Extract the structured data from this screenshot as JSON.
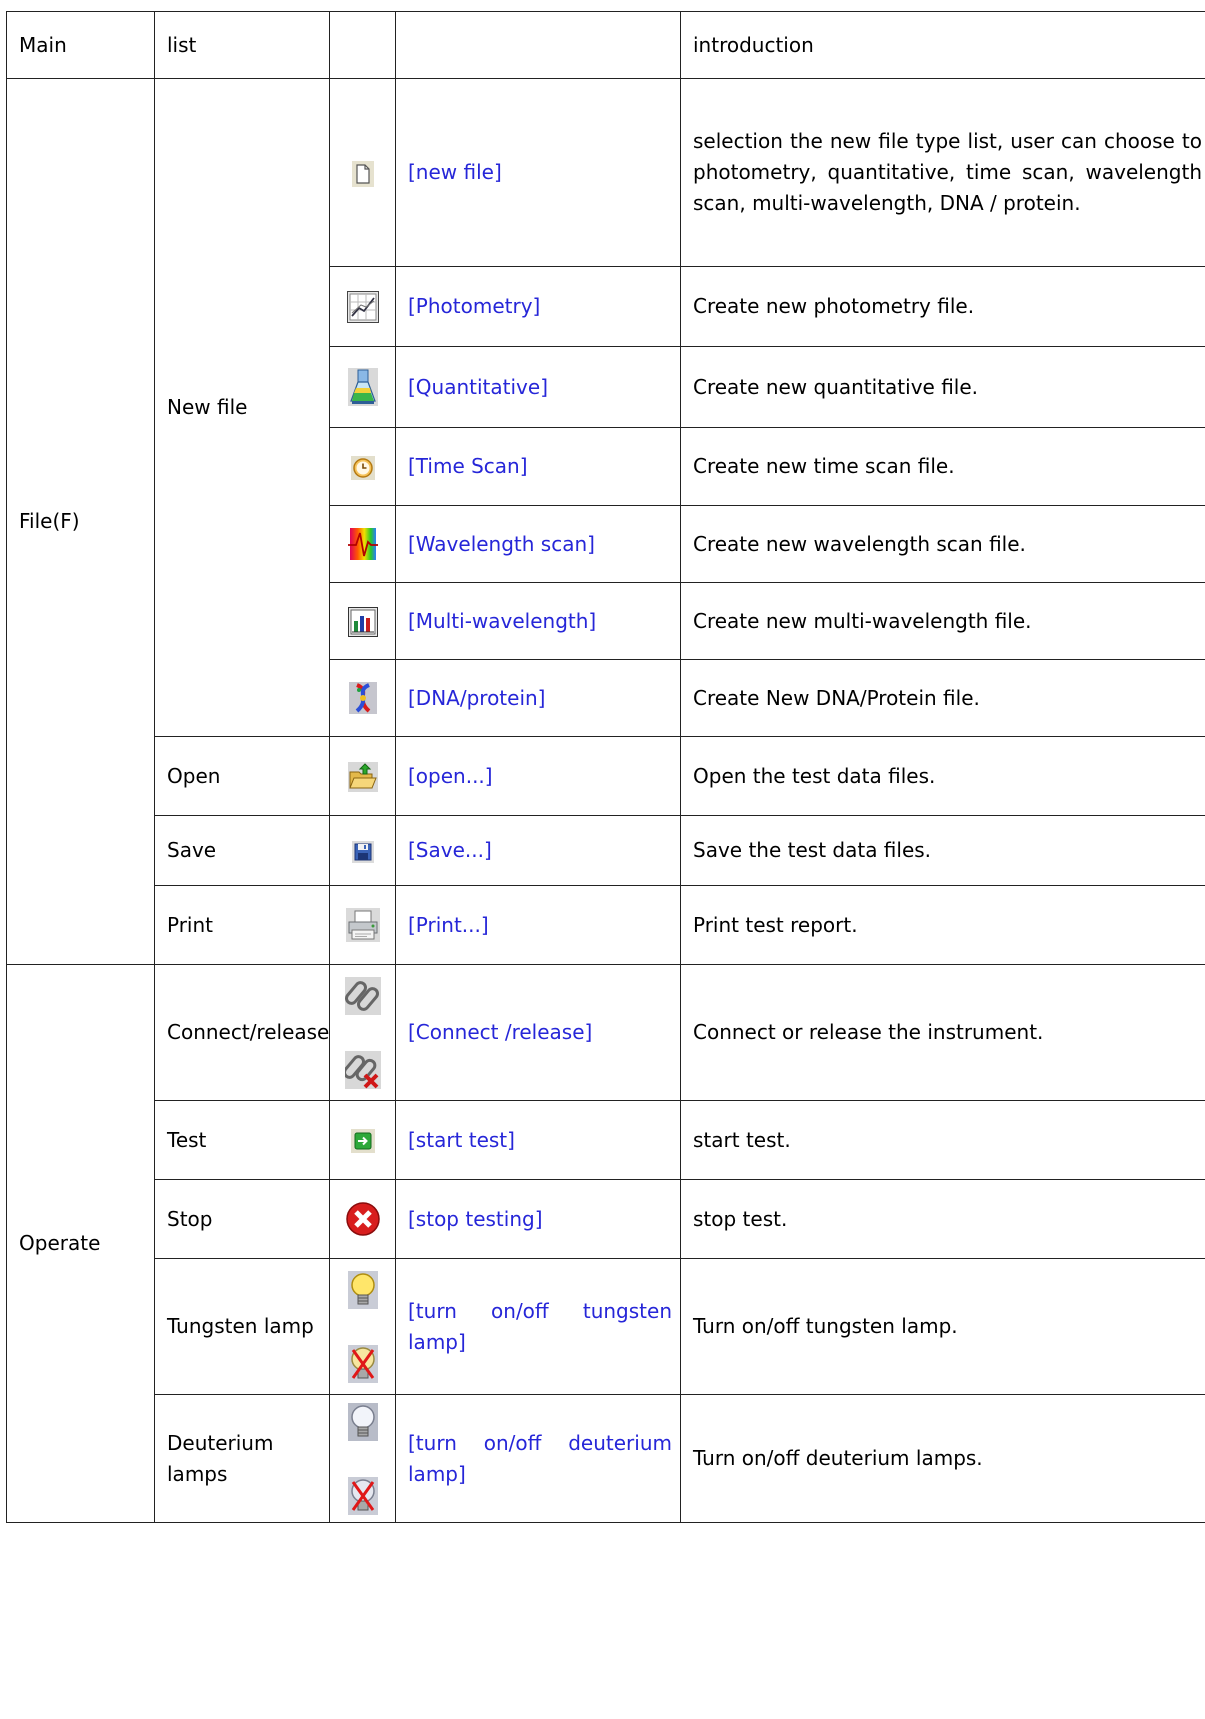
{
  "header": {
    "main": "Main",
    "list": "list",
    "introduction": "introduction"
  },
  "groups": {
    "file": "File(F)",
    "new_file": "New file",
    "operate": "Operate"
  },
  "rows": [
    {
      "icon": "blank-document-icon",
      "link": "[new file]",
      "intro": "selection the new file type list, user can choose to photometry, quantitative, time scan, wavelength scan, multi-wavelength, DNA / protein."
    },
    {
      "icon": "photometry-chart-icon",
      "link": "[Photometry]",
      "intro": "Create new photometry file."
    },
    {
      "icon": "flask-icon",
      "link": "[Quantitative]",
      "intro": "Create new quantitative file."
    },
    {
      "icon": "clock-icon",
      "link": "[Time Scan]",
      "intro": "Create new time scan file."
    },
    {
      "icon": "spectrum-wave-icon",
      "link": "[Wavelength scan]",
      "intro": "Create new wavelength scan file."
    },
    {
      "icon": "bar-chart-icon",
      "link": "[Multi-wavelength]",
      "intro": "Create new multi-wavelength file."
    },
    {
      "icon": "dna-icon",
      "link": "[DNA/protein]",
      "intro": "Create New DNA/Protein file."
    },
    {
      "label": "Open",
      "icon": "open-folder-icon",
      "link": "[open...]",
      "intro": "Open the test data files."
    },
    {
      "label": "Save",
      "icon": "floppy-disk-icon",
      "link": "[Save...]",
      "intro": "Save the test data files."
    },
    {
      "label": "Print",
      "icon": "printer-icon",
      "link": "[Print...]",
      "intro": "Print test report."
    },
    {
      "label": "Connect/release",
      "icons": [
        "link-connect-icon",
        "link-release-icon"
      ],
      "link": "[Connect /release]",
      "intro": "Connect or release the instrument."
    },
    {
      "label": "Test",
      "icon": "start-arrow-icon",
      "link": "[start test]",
      "intro": "start test."
    },
    {
      "label": "Stop",
      "icon": "stop-icon",
      "link": "[stop testing]",
      "intro": "stop test."
    },
    {
      "label": "Tungsten lamp",
      "icons": [
        "tungsten-bulb-on-icon",
        "tungsten-bulb-off-icon"
      ],
      "link": "[turn on/off tungsten lamp]",
      "intro": "Turn on/off tungsten lamp."
    },
    {
      "label": "Deuterium lamps",
      "icons": [
        "deuterium-bulb-on-icon",
        "deuterium-bulb-off-icon"
      ],
      "link": "[turn on/off deuterium lamp]",
      "intro": "Turn on/off deuterium lamps."
    }
  ],
  "colors": {
    "link": "#2626d8",
    "border": "#222222"
  }
}
